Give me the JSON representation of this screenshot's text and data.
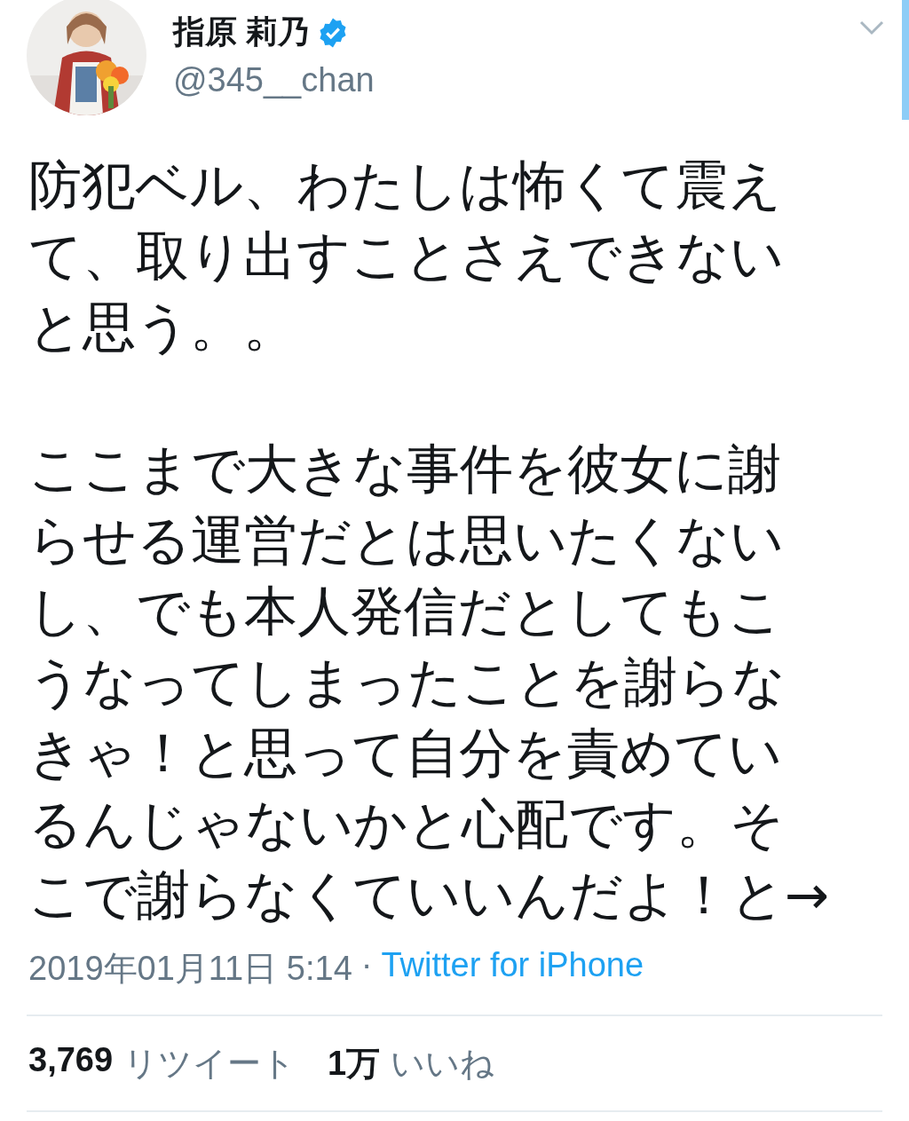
{
  "author": {
    "name": "指原 莉乃",
    "verified": true,
    "handle": "@345__chan"
  },
  "paragraphs": [
    "防犯ベル、わたしは怖くて震えて、取り出すことさえできないと思う。。",
    "ここまで大きな事件を彼女に謝らせる運営だとは思いたくないし、でも本人発信だとしてもこうなってしまったことを謝らなきゃ！と思って自分を責めているんじゃないかと心配です。そこで謝らなくていいんだよ！と→"
  ],
  "timestamp": "2019年01月11日 5:14",
  "separator": "·",
  "source": "Twitter for iPhone",
  "stats": [
    {
      "count": "3,769",
      "label": "リツイート"
    },
    {
      "count": "1万",
      "label": "いいね"
    }
  ]
}
